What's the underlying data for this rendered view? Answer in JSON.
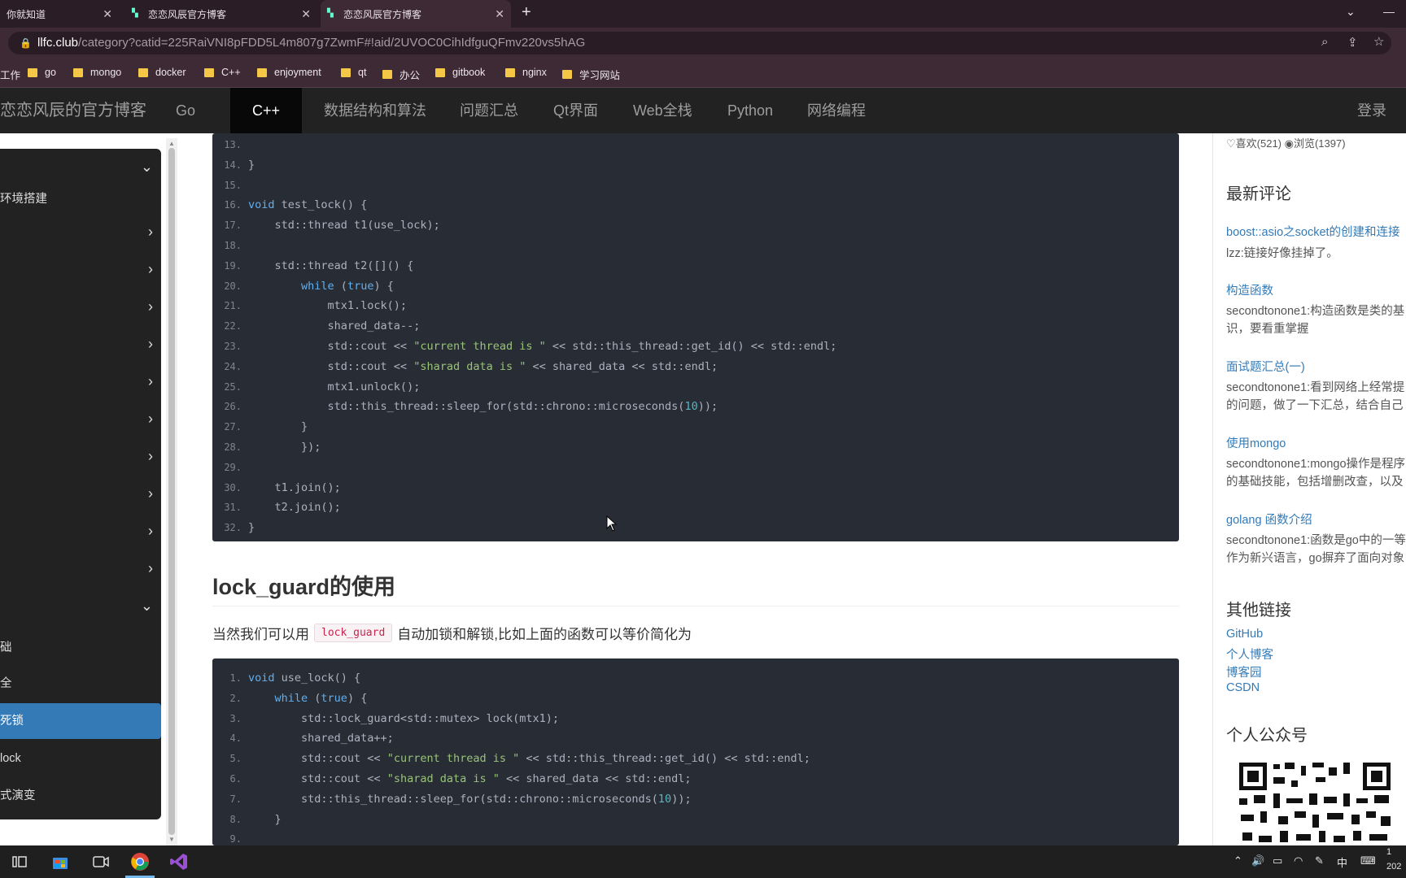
{
  "browser": {
    "tabs": [
      {
        "title": "你就知道"
      },
      {
        "title": "恋恋风辰官方博客"
      },
      {
        "title": "恋恋风辰官方博客",
        "active": true
      }
    ],
    "url_host": "llfc.club",
    "url_path": "/category?catid=225RaiVNI8pFDD5L4m807g7ZwmF#!aid/2UVOC0CihIdfguQFmv220vs5hAG",
    "bookmarks": [
      "工作",
      "go",
      "mongo",
      "docker",
      "C++",
      "enjoyment",
      "qt",
      "办公",
      "gitbook",
      "nginx",
      "学习网站"
    ]
  },
  "site": {
    "title": "恋恋风辰的官方博客",
    "nav": [
      "Go",
      "C++",
      "数据结构和算法",
      "问题汇总",
      "Qt界面",
      "Web全栈",
      "Python",
      "网络编程"
    ],
    "active_nav": "C++",
    "login": "登录"
  },
  "sidebar": {
    "items": [
      {
        "label": "",
        "chevron": "⌄"
      },
      {
        "label": "环境搭建",
        "chevron": ""
      },
      {
        "label": "",
        "chevron": "›"
      },
      {
        "label": "",
        "chevron": "›"
      },
      {
        "label": "",
        "chevron": "›"
      },
      {
        "label": "",
        "chevron": "›"
      },
      {
        "label": "",
        "chevron": "›"
      },
      {
        "label": "",
        "chevron": "›"
      },
      {
        "label": "",
        "chevron": "›"
      },
      {
        "label": "",
        "chevron": "›"
      },
      {
        "label": "",
        "chevron": "›"
      },
      {
        "label": "",
        "chevron": "›"
      },
      {
        "label": "",
        "chevron": "⌄"
      },
      {
        "label": "础",
        "chevron": ""
      },
      {
        "label": "全",
        "chevron": ""
      },
      {
        "label": "死锁",
        "chevron": "",
        "active": true
      },
      {
        "label": "lock",
        "chevron": ""
      },
      {
        "label": "式演变",
        "chevron": ""
      }
    ]
  },
  "code_block_1": {
    "lines": [
      {
        "n": "13.",
        "html": ""
      },
      {
        "n": "14.",
        "html": "}"
      },
      {
        "n": "15.",
        "html": ""
      },
      {
        "n": "16.",
        "html": "<span class=\"kw\">void</span> test_lock() {"
      },
      {
        "n": "17.",
        "html": "    std::thread t1(use_lock);"
      },
      {
        "n": "18.",
        "html": ""
      },
      {
        "n": "19.",
        "html": "    std::thread t2([]() {"
      },
      {
        "n": "20.",
        "html": "        <span class=\"kw\">while</span> (<span class=\"kw\">true</span>) {"
      },
      {
        "n": "21.",
        "html": "            mtx1.lock();"
      },
      {
        "n": "22.",
        "html": "            shared_data--;"
      },
      {
        "n": "23.",
        "html": "            std::cout &lt;&lt; <span class=\"str\">\"current thread is \"</span> &lt;&lt; std::this_thread::get_id() &lt;&lt; std::endl;"
      },
      {
        "n": "24.",
        "html": "            std::cout &lt;&lt; <span class=\"str\">\"sharad data is \"</span> &lt;&lt; shared_data &lt;&lt; std::endl;"
      },
      {
        "n": "25.",
        "html": "            mtx1.unlock();"
      },
      {
        "n": "26.",
        "html": "            std::this_thread::sleep_for(std::chrono::microseconds(<span class=\"num\">10</span>));"
      },
      {
        "n": "27.",
        "html": "        }"
      },
      {
        "n": "28.",
        "html": "        });"
      },
      {
        "n": "29.",
        "html": ""
      },
      {
        "n": "30.",
        "html": "    t1.join();"
      },
      {
        "n": "31.",
        "html": "    t2.join();"
      },
      {
        "n": "32.",
        "html": "}"
      }
    ]
  },
  "section": {
    "heading": "lock_guard的使用",
    "para_before": "当然我们可以用",
    "para_code": "lock_guard",
    "para_after": "自动加锁和解锁,比如上面的函数可以等价简化为"
  },
  "code_block_2": {
    "lines": [
      {
        "n": "1.",
        "html": "<span class=\"kw\">void</span> use_lock() {"
      },
      {
        "n": "2.",
        "html": "    <span class=\"kw\">while</span> (<span class=\"kw\">true</span>) {"
      },
      {
        "n": "3.",
        "html": "        std::lock_guard&lt;std::mutex&gt; lock(mtx1);"
      },
      {
        "n": "4.",
        "html": "        shared_data++;"
      },
      {
        "n": "5.",
        "html": "        std::cout &lt;&lt; <span class=\"str\">\"current thread is \"</span> &lt;&lt; std::this_thread::get_id() &lt;&lt; std::endl;"
      },
      {
        "n": "6.",
        "html": "        std::cout &lt;&lt; <span class=\"str\">\"sharad data is \"</span> &lt;&lt; shared_data &lt;&lt; std::endl;"
      },
      {
        "n": "7.",
        "html": "        std::this_thread::sleep_for(std::chrono::microseconds(<span class=\"num\">10</span>));"
      },
      {
        "n": "8.",
        "html": "    }"
      },
      {
        "n": "9.",
        "html": ""
      }
    ]
  },
  "right": {
    "stats": "♡喜欢(521)   ◉浏览(1397)",
    "latest_comments_title": "最新评论",
    "comments": [
      {
        "link": "boost::asio之socket的创建和连接",
        "lines": [
          "lzz:链接好像挂掉了。"
        ]
      },
      {
        "link": "构造函数",
        "lines": [
          "secondtonone1:构造函数是类的基",
          "识，要看重掌握"
        ]
      },
      {
        "link": "面试题汇总(一)",
        "lines": [
          "secondtonone1:看到网络上经常提",
          "的问题，做了一下汇总，结合自己"
        ]
      },
      {
        "link": "使用mongo",
        "lines": [
          "secondtonone1:mongo操作是程序",
          "的基础技能，包括增删改查，以及"
        ]
      },
      {
        "link": "golang 函数介绍",
        "lines": [
          "secondtonone1:函数是go中的一等",
          "作为新兴语言，go摒弃了面向对象"
        ]
      }
    ],
    "other_links_title": "其他链接",
    "other_links": [
      "GitHub",
      "个人博客",
      "博客园",
      "CSDN"
    ],
    "wechat_title": "个人公众号"
  },
  "taskbar": {
    "tray_ime": "中",
    "clock_top": "1",
    "clock_bottom": "202"
  }
}
